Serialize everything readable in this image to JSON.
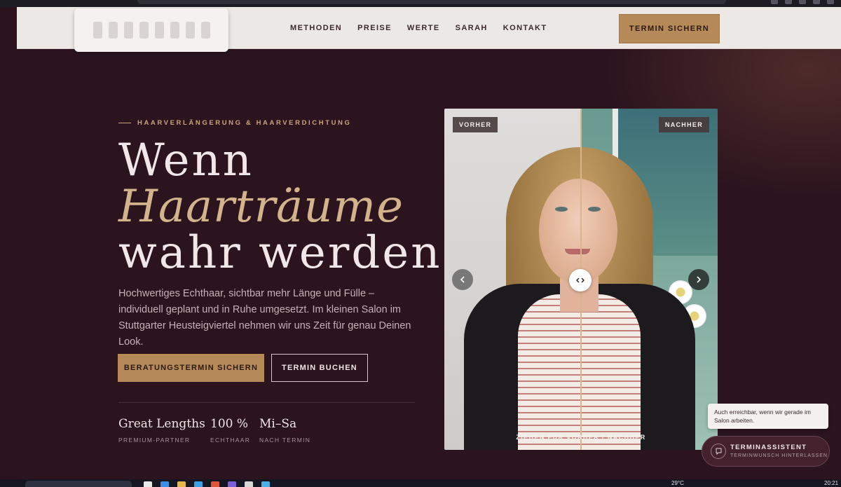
{
  "nav": {
    "links": [
      "METHODEN",
      "PREISE",
      "WERTE",
      "SARAH",
      "KONTAKT"
    ],
    "cta": "TERMIN SICHERN"
  },
  "hero": {
    "eyebrow": "HAARVERLÄNGERUNG & HAARVERDICHTUNG",
    "headline": [
      "Wenn",
      "Haarträume",
      "wahr werden"
    ],
    "lead": "Hochwertiges Echthaar, sichtbar mehr Länge und Fülle – individuell geplant und in Ruhe umgesetzt. Im kleinen Salon im Stuttgarter Heusteigviertel nehmen wir uns Zeit für genau Deinen Look.",
    "primary_button": "BERATUNGSTERMIN SICHERN",
    "secondary_button": "TERMIN BUCHEN",
    "stats": [
      {
        "value": "Great Lengths",
        "label": "PREMIUM-PARTNER"
      },
      {
        "value": "100 %",
        "label": "ECHTHAAR"
      },
      {
        "value": "Mi–Sa",
        "label": "NACH TERMIN"
      }
    ]
  },
  "compare": {
    "before_label": "VORHER",
    "after_label": "NACHHER",
    "caption": "ZIEHEN FÜR VORHER / NACHHER",
    "split_fraction": 0.5
  },
  "assistant": {
    "tooltip": "Auch erreichbar, wenn wir gerade im Salon arbeiten.",
    "title": "TERMINASSISTENT",
    "subtitle": "TERMINWUNSCH HINTERLASSEN"
  },
  "taskbar": {
    "temperature": "29°C",
    "time": "20:21"
  },
  "colors": {
    "background": "#2b141e",
    "accent": "#b58a58",
    "headline_accent": "#d3b38c"
  }
}
